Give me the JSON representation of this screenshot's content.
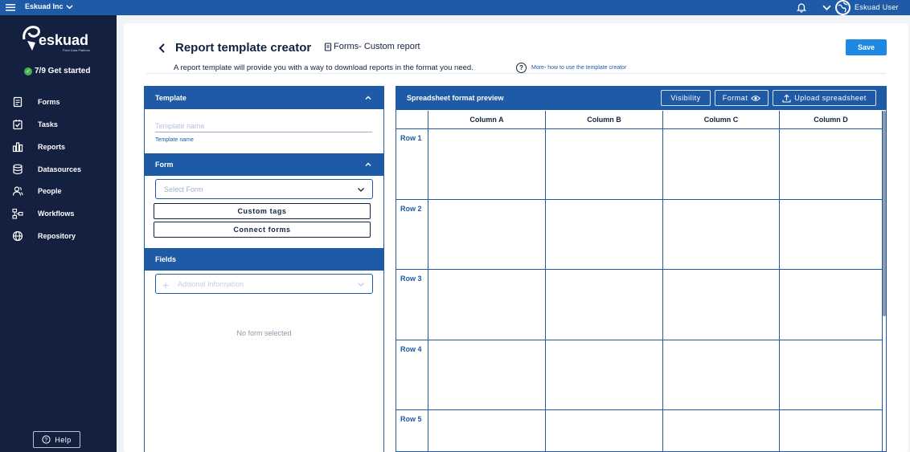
{
  "topbar": {
    "org": "Eskuad Inc",
    "user": "Eskuad User"
  },
  "sidebar": {
    "logo_text": "eskuad",
    "logo_tagline": "Field Data Platform",
    "get_started": "7/9 Get started",
    "items": [
      {
        "label": "Forms",
        "icon": "forms-icon"
      },
      {
        "label": "Tasks",
        "icon": "tasks-icon"
      },
      {
        "label": "Reports",
        "icon": "reports-icon"
      },
      {
        "label": "Datasources",
        "icon": "datasources-icon"
      },
      {
        "label": "People",
        "icon": "people-icon"
      },
      {
        "label": "Workflows",
        "icon": "workflows-icon"
      },
      {
        "label": "Repository",
        "icon": "globe-icon"
      }
    ],
    "help": "Help"
  },
  "header": {
    "title": "Report template creator",
    "subtitle": "Forms- Custom report",
    "description": "A report template will provide you with a way to download reports in the format you need.",
    "help_link": "More- how to use the template creator",
    "save": "Save"
  },
  "template_section": {
    "title": "Template",
    "name_placeholder": "Template name",
    "name_label": "Template name"
  },
  "form_section": {
    "title": "Form",
    "select_placeholder": "Select Form",
    "custom_tags": "Custom tags",
    "connect_forms": "Connect forms"
  },
  "fields_section": {
    "title": "Fields",
    "add_placeholder": "Aditional Information",
    "empty": "No form selected"
  },
  "preview": {
    "title": "Spreadsheet format preview",
    "visibility": "Visibility",
    "format": "Format",
    "upload": "Upload spreadsheet",
    "columns": [
      "Column A",
      "Column B",
      "Column C",
      "Column D"
    ],
    "rows": [
      "Row 1",
      "Row 2",
      "Row 3",
      "Row 4",
      "Row 5"
    ]
  },
  "colors": {
    "primary": "#1e5aa6",
    "sidebar": "#132040",
    "save": "#1e88e5"
  }
}
